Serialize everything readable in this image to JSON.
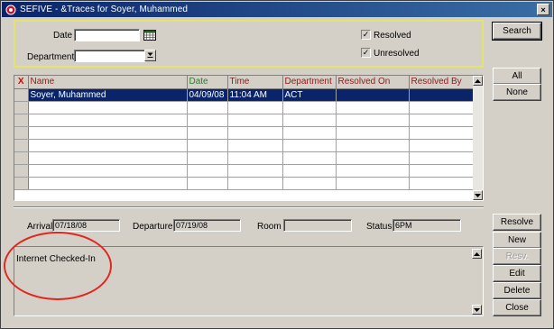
{
  "window": {
    "title": "SEFIVE - &Traces for Soyer, Muhammed",
    "close_glyph": "×"
  },
  "search": {
    "date_label": "Date",
    "date_value": "",
    "department_label": "Department",
    "department_value": "",
    "resolved_label": "Resolved",
    "resolved_checked": true,
    "unresolved_label": "Unresolved",
    "unresolved_checked": true,
    "check_glyph": "✓"
  },
  "buttons": {
    "search": "Search",
    "all": "All",
    "none": "None",
    "resolve": "Resolve",
    "new": "New",
    "resv": "Resv.",
    "edit": "Edit",
    "delete": "Delete",
    "close": "Close"
  },
  "grid": {
    "columns": {
      "x": "X",
      "name": "Name",
      "date": "Date",
      "time": "Time",
      "department": "Department",
      "resolved_on": "Resolved On",
      "resolved_by": "Resolved By"
    },
    "rows": [
      {
        "name": "Soyer, Muhammed",
        "date": "04/09/08",
        "time": "11:04 AM",
        "department": "ACT",
        "resolved_on": "",
        "resolved_by": ""
      }
    ],
    "empty_row_count": 7
  },
  "details": {
    "arrival_label": "Arrival",
    "arrival_value": "07/18/08",
    "departure_label": "Departure",
    "departure_value": "07/19/08",
    "room_label": "Room",
    "room_value": "",
    "status_label": "Status",
    "status_value": "6PM"
  },
  "notes": {
    "text": "Internet Checked-In"
  },
  "colors": {
    "title_bar_start": "#0a246a",
    "title_bar_end": "#3a6ea5",
    "selection": "#0a246a",
    "search_panel_border": "#e4e46c",
    "annotation_circle": "#e0281e",
    "header_text": "#8b1c1c",
    "header_text_green": "#2e7d2e"
  }
}
